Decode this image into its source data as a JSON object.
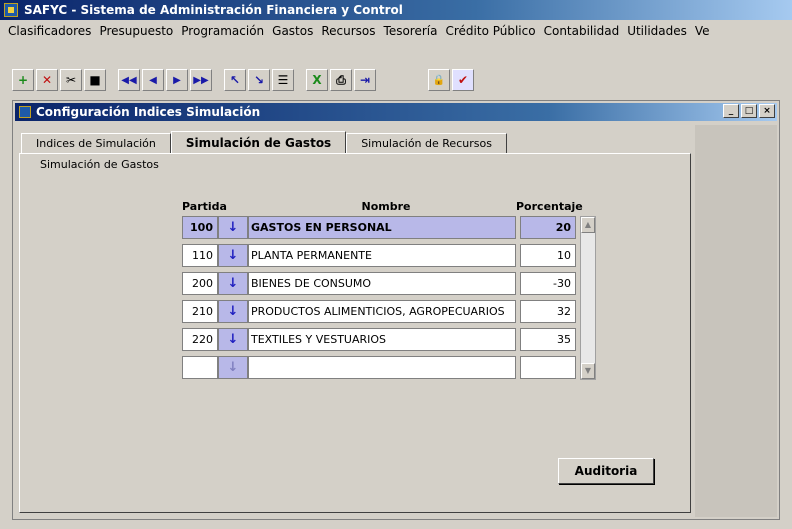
{
  "app": {
    "title": "SAFYC - Sistema de Administración Financiera y Control"
  },
  "menu": [
    "Clasificadores",
    "Presupuesto",
    "Programación",
    "Gastos",
    "Recursos",
    "Tesorería",
    "Crédito Público",
    "Contabilidad",
    "Utilidades",
    "Ve"
  ],
  "toolbar": {
    "buttons": [
      "add-record-icon",
      "delete-record-icon",
      "cut-icon",
      "save-icon",
      "first-record-icon",
      "previous-record-icon",
      "next-record-icon",
      "last-record-icon",
      "query-icon",
      "execute-query-icon",
      "list-icon",
      "excel-icon",
      "print-icon",
      "exit-icon",
      "lock-icon",
      "check-icon"
    ],
    "glyphs": [
      "+",
      "✕",
      "✂",
      "■",
      "◀◀",
      "◀",
      "▶",
      "▶▶",
      "↖",
      "↘",
      "☰",
      "X",
      "⎙",
      "⇥",
      "🔒",
      "✔"
    ]
  },
  "window": {
    "title": "Configuración Indices Simulación",
    "controls": {
      "minimize": "_",
      "maximize": "□",
      "close": "×"
    }
  },
  "tabs": [
    {
      "label": "Indices de Simulación"
    },
    {
      "label": "Simulación de Gastos"
    },
    {
      "label": "Simulación de Recursos"
    }
  ],
  "panel": {
    "label": "Simulación de Gastos",
    "headers": {
      "partida": "Partida",
      "nombre": "Nombre",
      "porcentaje": "Porcentaje"
    },
    "rows": [
      {
        "partida": "100",
        "nombre": "GASTOS EN PERSONAL",
        "porcentaje": "20"
      },
      {
        "partida": "110",
        "nombre": "PLANTA PERMANENTE",
        "porcentaje": "10"
      },
      {
        "partida": "200",
        "nombre": "BIENES DE CONSUMO",
        "porcentaje": "-30"
      },
      {
        "partida": "210",
        "nombre": "PRODUCTOS ALIMENTICIOS, AGROPECUARIOS",
        "porcentaje": "32"
      },
      {
        "partida": "220",
        "nombre": "TEXTILES Y VESTUARIOS",
        "porcentaje": "35"
      },
      {
        "partida": "",
        "nombre": "",
        "porcentaje": ""
      }
    ],
    "lov_glyph": "↓",
    "auditoria_label": "Auditoria"
  }
}
